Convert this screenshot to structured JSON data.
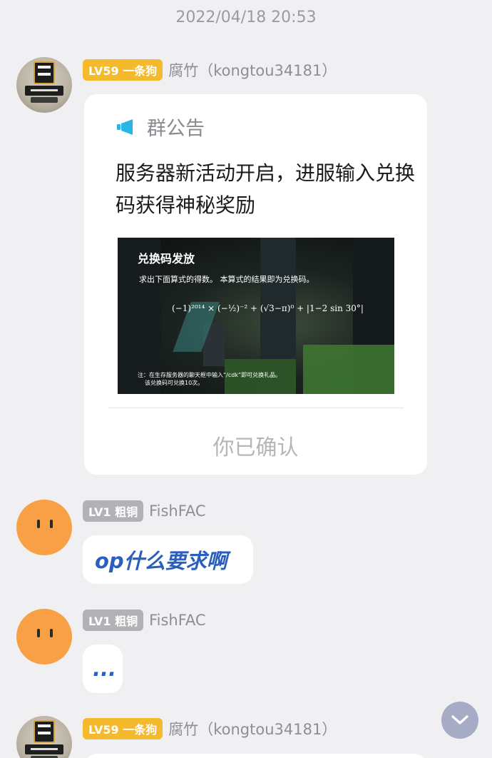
{
  "timestamp": "2022/04/18 20:53",
  "messages": [
    {
      "level": "LV59 一条狗",
      "sender": "腐竹（kongtou34181）",
      "notice": {
        "title": "群公告",
        "body": "服务器新活动开启，进服输入兑换码获得神秘奖励",
        "image": {
          "title": "兑换码发放",
          "subtitle": "求出下面算式的得数。 本算式的结果即为兑换码。",
          "formula": "(−1)²⁰¹⁴ × (−½)⁻² + (√3−π)⁰ + |1−2 sin 30°|",
          "note_line1": "注：在生存服务器的聊天框中输入“/cdk”即可兑换礼品。",
          "note_line2": "该兑换码可兑换10次。"
        },
        "confirm": "你已确认"
      }
    },
    {
      "level": "LV1 粗铜",
      "sender": "FishFAC",
      "text": "op什么要求啊"
    },
    {
      "level": "LV1 粗铜",
      "sender": "FishFAC",
      "text": "..."
    },
    {
      "level": "LV59 一条狗",
      "sender": "腐竹（kongtou34181）"
    }
  ],
  "colors": {
    "background": "#f0f0f3",
    "level_gold": "#f5b92d",
    "level_gray": "#b2b2b6",
    "link_blue": "#2b5fbe",
    "announcement_icon": "#29b6e6",
    "scroll_button": "#a7acc6"
  },
  "icons": {
    "announcement": "megaphone-icon",
    "scroll_down": "chevron-down-icon"
  }
}
